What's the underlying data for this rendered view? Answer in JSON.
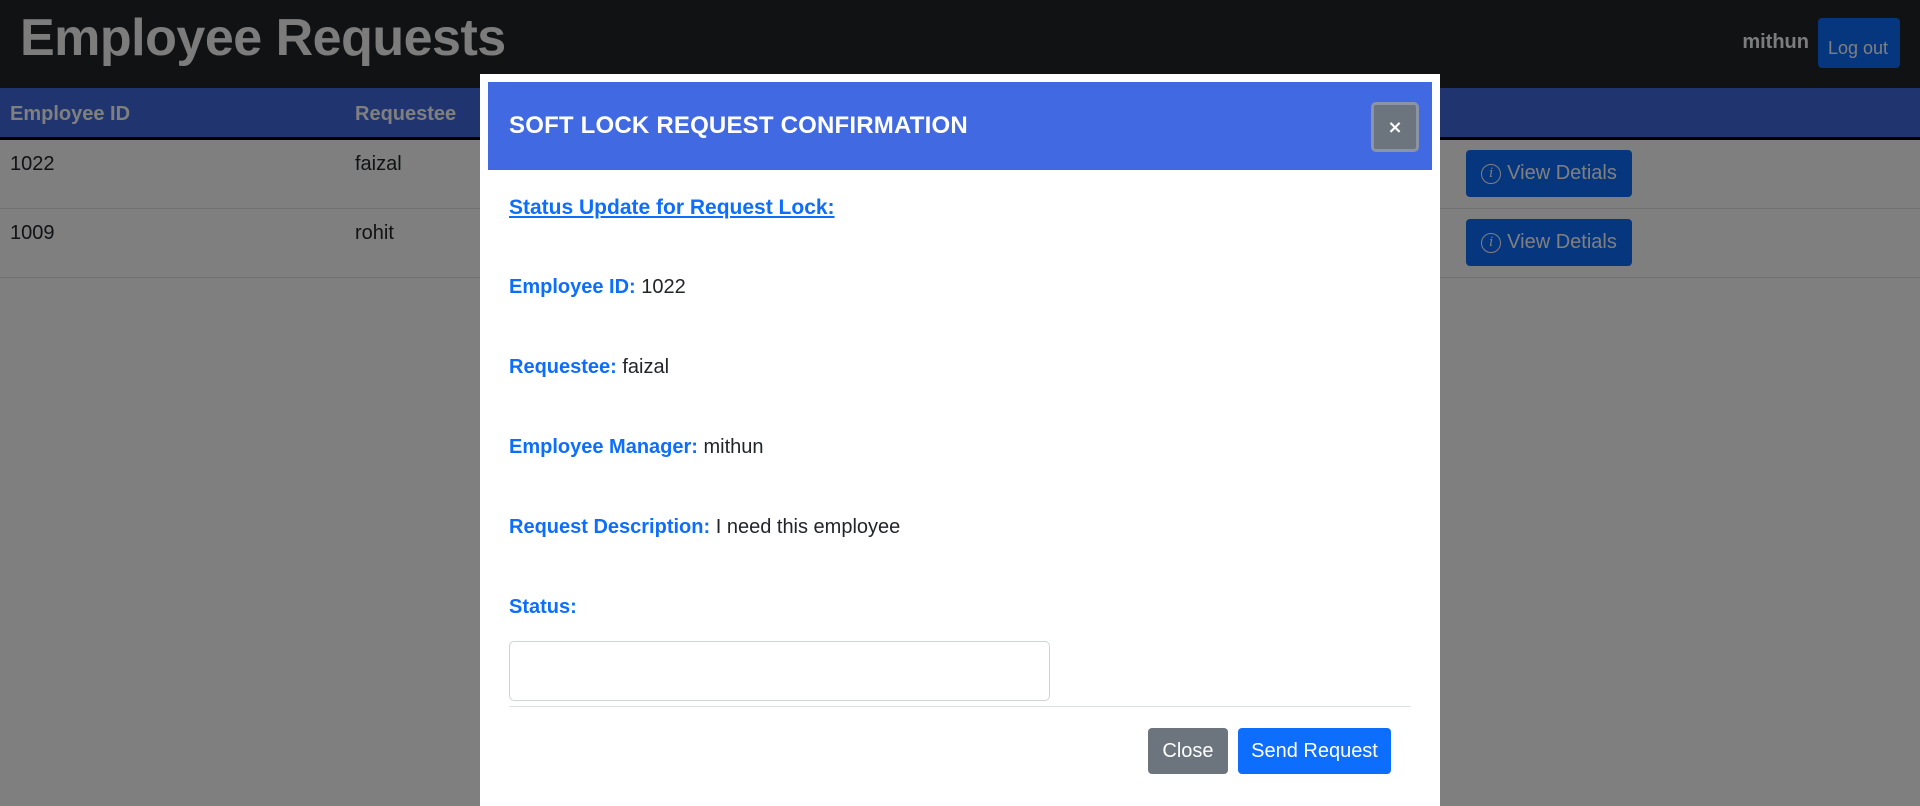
{
  "header": {
    "title": "Employee Requests",
    "user": "mithun",
    "logout_label": "Log out"
  },
  "table": {
    "columns": [
      "Employee ID",
      "Requestee"
    ],
    "rows": [
      {
        "employee_id": "1022",
        "requestee": "faizal",
        "action": "View Detials"
      },
      {
        "employee_id": "1009",
        "requestee": "rohit",
        "action": "View Detials"
      }
    ]
  },
  "modal": {
    "title": "SOFT LOCK REQUEST CONFIRMATION",
    "close_symbol": "×",
    "section_title": "Status Update for Request Lock:",
    "fields": [
      {
        "label": "Employee ID:",
        "value": "1022"
      },
      {
        "label": "Requestee:",
        "value": "faizal"
      },
      {
        "label": "Employee Manager:",
        "value": "mithun"
      },
      {
        "label": "Request Description:",
        "value": "I need this employee"
      }
    ],
    "status_label": "Status:",
    "status_value": "",
    "close_button": "Close",
    "send_button": "Send Request"
  },
  "colors": {
    "topbar": "#212529",
    "accent": "#4169e1",
    "primary": "#0d6efd",
    "secondary": "#6c757d"
  },
  "icons": {
    "view_details": "info-icon",
    "modal_close": "close-icon"
  }
}
